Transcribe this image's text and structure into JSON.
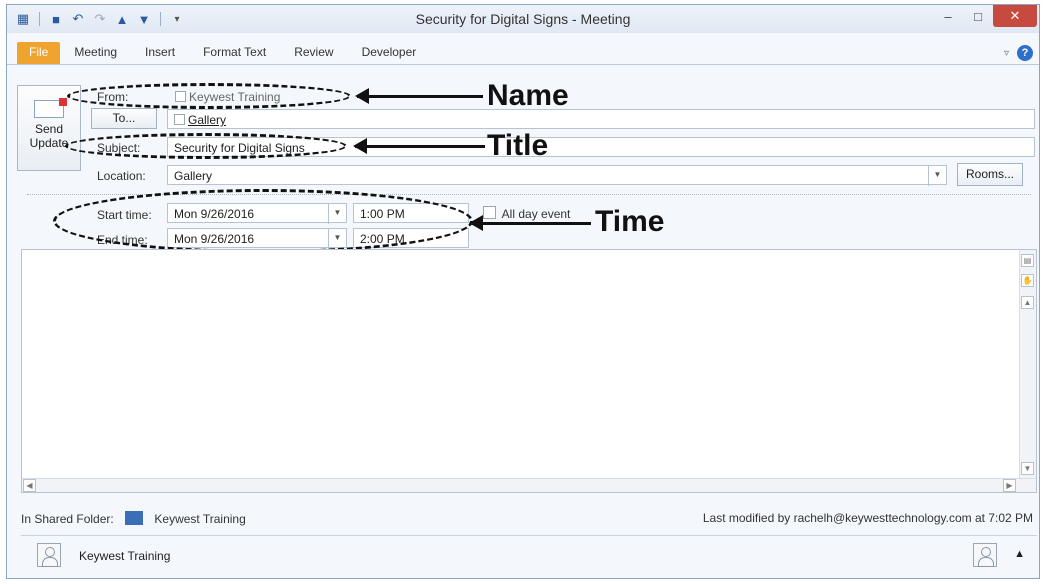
{
  "window": {
    "title": "Security for Digital Signs - Meeting"
  },
  "qat": {
    "icons": [
      "calendar-icon",
      "save-icon",
      "undo-icon",
      "redo-icon",
      "previous-icon",
      "next-icon",
      "customize-icon"
    ]
  },
  "ribbon": {
    "tabs": [
      "File",
      "Meeting",
      "Insert",
      "Format Text",
      "Review",
      "Developer"
    ],
    "help": "?"
  },
  "send": {
    "label": "Send Update"
  },
  "form": {
    "from_label": "From:",
    "from_value": "Keywest Training",
    "to_button": "To...",
    "to_value": "Gallery",
    "subject_label": "Subject:",
    "subject_value": "Security for Digital Signs",
    "location_label": "Location:",
    "location_value": "Gallery",
    "rooms_button": "Rooms...",
    "start_label": "Start time:",
    "start_date": "Mon 9/26/2016",
    "start_time": "1:00 PM",
    "end_label": "End time:",
    "end_date": "Mon 9/26/2016",
    "end_time": "2:00 PM",
    "all_day_label": "All day event"
  },
  "annotations": {
    "name": "Name",
    "title": "Title",
    "time": "Time"
  },
  "footer": {
    "folder_label": "In Shared Folder:",
    "folder_name": "Keywest Training",
    "modified": "Last modified by rachelh@keywesttechnology.com at 7:02 PM"
  },
  "people": {
    "name": "Keywest Training"
  }
}
